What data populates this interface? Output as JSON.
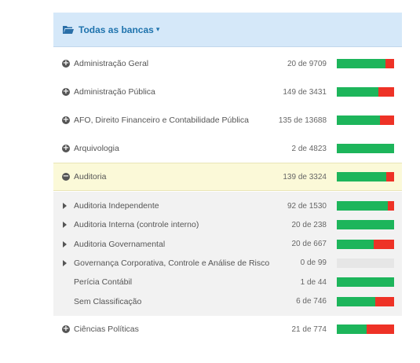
{
  "header": {
    "title": "Todas as bancas",
    "chevron_icon": "chevron-down-icon",
    "folder_icon": "folder-open-icon"
  },
  "colors": {
    "correct": "#1db55b",
    "wrong": "#ee3226",
    "empty": "#e6e6e6",
    "header_bg": "#d5e8f9",
    "active_bg": "#fbf9d8"
  },
  "rows": [
    {
      "label": "Administração Geral",
      "count": "20 de 9709",
      "correct_fraction": 0.85,
      "icon": "plus-circle-icon"
    },
    {
      "label": "Administração Pública",
      "count": "149 de 3431",
      "correct_fraction": 0.73,
      "icon": "plus-circle-icon"
    },
    {
      "label": "AFO, Direito Financeiro e Contabilidade Pública",
      "count": "135 de 13688",
      "correct_fraction": 0.75,
      "icon": "plus-circle-icon"
    },
    {
      "label": "Arquivologia",
      "count": "2 de 4823",
      "correct_fraction": 1.0,
      "icon": "plus-circle-icon"
    },
    {
      "label": "Auditoria",
      "count": "139 de 3324",
      "correct_fraction": 0.86,
      "icon": "minus-circle-icon",
      "active": true
    }
  ],
  "subrows": [
    {
      "label": "Auditoria Independente",
      "count": "92 de 1530",
      "correct_fraction": 0.89,
      "icon": "caret-right-icon"
    },
    {
      "label": "Auditoria Interna (controle interno)",
      "count": "20 de 238",
      "correct_fraction": 1.0,
      "icon": "caret-right-icon"
    },
    {
      "label": "Auditoria Governamental",
      "count": "20 de 667",
      "correct_fraction": 0.65,
      "icon": "caret-right-icon"
    },
    {
      "label": "Governança Corporativa, Controle e Análise de Risco",
      "count": "0 de 99",
      "correct_fraction": 0,
      "empty": true,
      "icon": "caret-right-icon"
    },
    {
      "label": "Perícia Contábil",
      "count": "1 de 44",
      "correct_fraction": 1.0
    },
    {
      "label": "Sem Classificação",
      "count": "6 de 746",
      "correct_fraction": 0.67
    }
  ],
  "footer_rows": [
    {
      "label": "Ciências Políticas",
      "count": "21 de 774",
      "correct_fraction": 0.52,
      "icon": "plus-circle-icon"
    }
  ]
}
